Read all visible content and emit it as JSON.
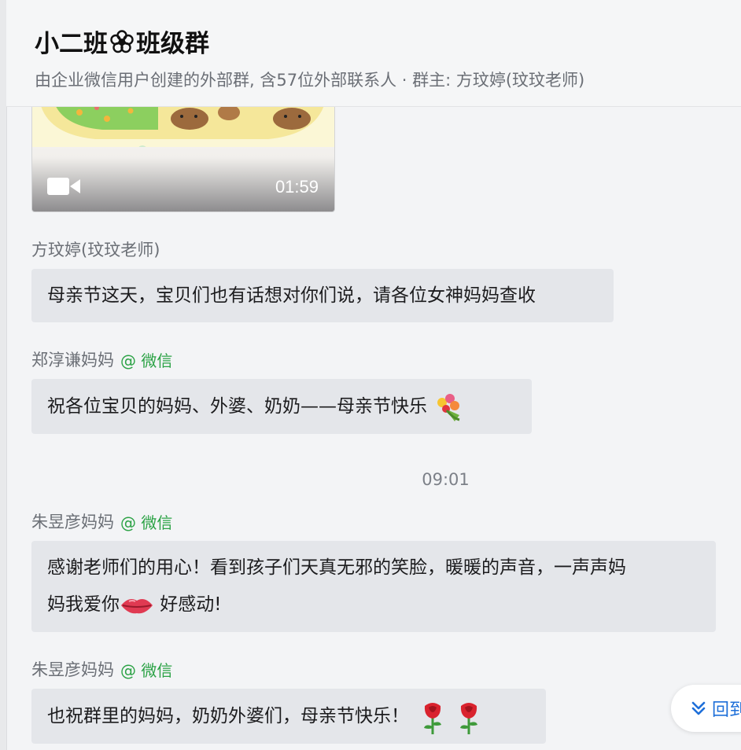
{
  "header": {
    "title_part1": "小二班",
    "title_part2": "班级群",
    "subtitle": "由企业微信用户创建的外部群, 含57位外部联系人 · 群主: 方玟婷(玟玟老师)"
  },
  "video": {
    "duration": "01:59"
  },
  "messages": [
    {
      "sender": "方玟婷(玟玟老师)",
      "tag": "",
      "text": "母亲节这天，宝贝们也有话想对你们说，请各位女神妈妈查收"
    },
    {
      "sender": "郑淳谦妈妈",
      "tag": "@ 微信",
      "text": "祝各位宝贝的妈妈、外婆、奶奶——母亲节快乐"
    },
    {
      "sender": "朱昱彦妈妈",
      "tag": "@ 微信",
      "text_line1": "感谢老师们的用心！看到孩子们天真无邪的笑脸，暖暖的声音，一声声妈",
      "text_line2a": "妈我爱你",
      "text_line2b": " 好感动!"
    },
    {
      "sender": "朱昱彦妈妈",
      "tag": "@ 微信",
      "text": "也祝群里的妈妈，奶奶外婆们，母亲节快乐！"
    }
  ],
  "timestamp": "09:01",
  "scroll_button": {
    "label": "回到"
  },
  "icons": [
    "flower-icon",
    "video-camera-icon",
    "bouquet-emoji",
    "lips-emoji",
    "rose-emoji",
    "chevron-double-down-icon"
  ],
  "colors": {
    "wechat_green": "#2ba245",
    "bubble": "#e4e6ea",
    "link_blue": "#1e6fd9"
  }
}
